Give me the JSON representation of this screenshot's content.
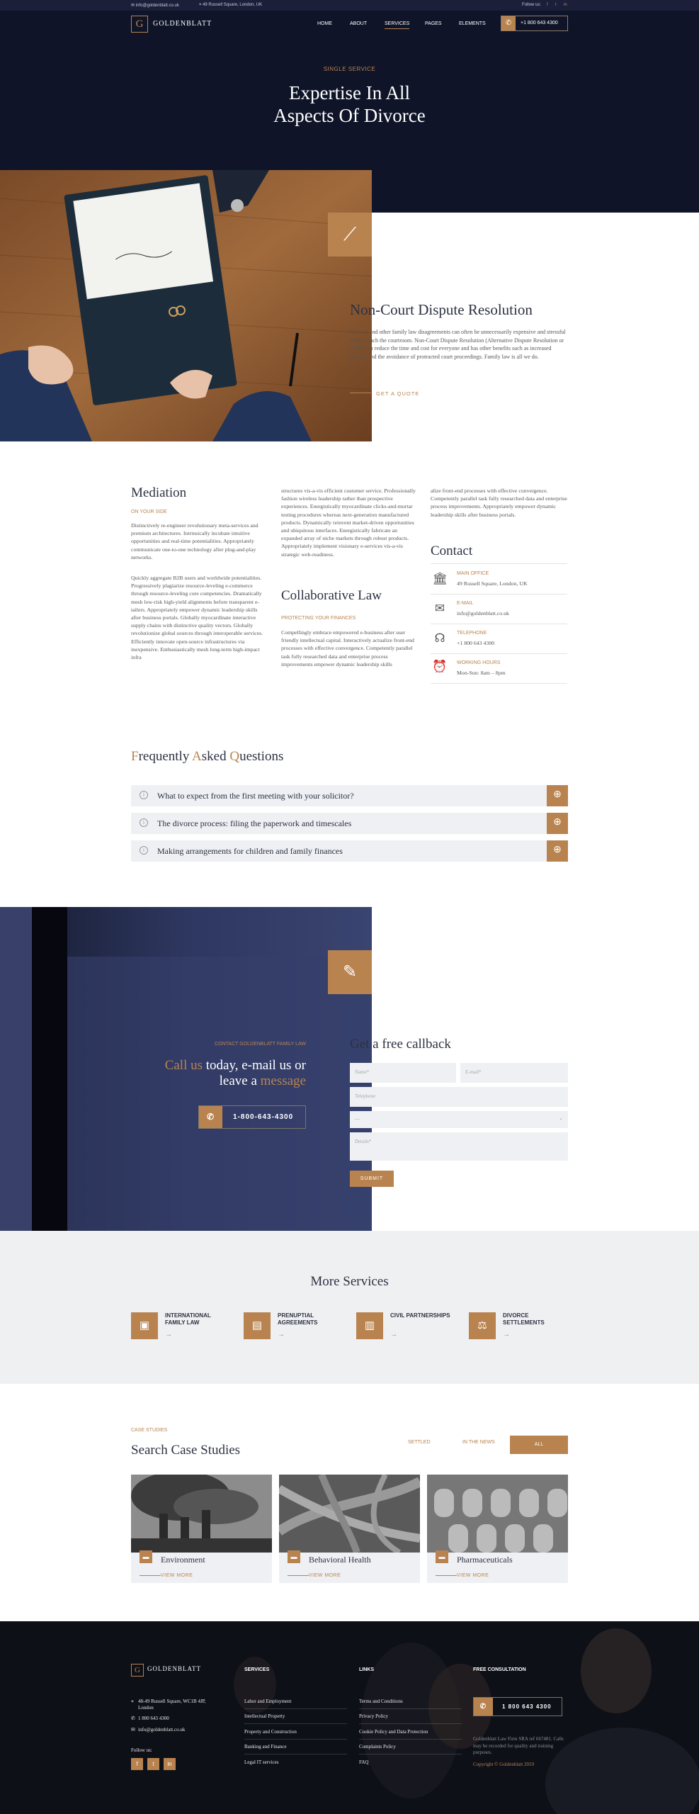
{
  "topbar": {
    "email": "info@goldenblatt.co.uk",
    "address": "49 Russell Square, London, UK",
    "follow": "Follow us:"
  },
  "nav": {
    "logo_letter": "G",
    "logo_text": "GOLDENBLATT",
    "items": [
      "HOME",
      "ABOUT",
      "SERVICES",
      "PAGES",
      "ELEMENTS"
    ],
    "active": "SERVICES",
    "phone": "+1 800 643 4300"
  },
  "hero": {
    "kicker": "SINGLE SERVICE",
    "title_line1": "Expertise In All",
    "title_line2": "Aspects Of Divorce"
  },
  "ncdr": {
    "title": "Non-Court Dispute Resolution",
    "text": "Divorce and other family law disagreements can often be unnecessarily expensive and stressful if they reach the courtroom. Non-Court Dispute Resolution (Alternative Dispute Resolution or ADR) can reduce the time and cost for everyone and has other benefits such as increased privacy and the avoidance of protracted court proceedings. Family law is all we do.",
    "link": "GET A QUOTE"
  },
  "mediation": {
    "title": "Mediation",
    "subtitle": "ON YOUR SIDE",
    "p1": "Distinctively re-engineer revolutionary meta-services and premium architectures. Intrinsically incubate intuitive opportunities and real-time potentialities. Appropriately communicate one-to-one technology after plug-and-play networks.",
    "p2": "Quickly aggregate B2B users and worldwide potentialities. Progressively plagiarize resource-leveling e-commerce through resource-leveling core competencies. Dramatically mesh low-risk high-yield alignments before transparent e-tailers. Appropriately empower dynamic leadership skills after business portals. Globally myocardinate interactive supply chains with distinctive quality vectors. Globally revolutionize global sources through interoperable services. Efficiently innovate open-source infrastructures via inexpensive. Enthusiastically mesh long-term high-impact infra"
  },
  "col2": {
    "p1": "structures vis-a-vis efficient customer service. Professionally fashion wireless leadership rather than prospective experiences. Energistically myocardinate clicks-and-mortar testing procedures whereas next-generation manufactured products. Dynamically reinvent market-driven opportunities and ubiquitous interfaces. Energistically fabricate an expanded array of niche markets through robust products. Appropriately implement visionary e-services vis-a-vis strategic web-readiness.",
    "title": "Collaborative Law",
    "subtitle": "PROTECTING YOUR FINANCES",
    "p2": "Compellingly embrace empowered e-business after user friendly intellectual capital. Interactively actualize front-end processes with effective convergence. Competently parallel task fully researched data and enterprise process improvements empower dynamic leadership skills"
  },
  "col3": {
    "p1": "alize front-end processes with effective convergence. Competently parallel task fully researched data and enterprise process improvements. Appropriately empower dynamic leadership skills after business portals.",
    "contact_title": "Contact",
    "items": [
      {
        "label": "MAIN OFFICE",
        "value": "49 Russell Square, London, UK",
        "icon": "bank-icon"
      },
      {
        "label": "E-MAIL",
        "value": "info@goldenblatt.co.uk",
        "icon": "envelope-icon"
      },
      {
        "label": "TELEPHONE",
        "value": "+1 800 643 4300",
        "icon": "headset-icon"
      },
      {
        "label": "WORKING HOURS",
        "value": "Mon-Sun: 8am – 8pm",
        "icon": "alarm-clock-icon"
      }
    ]
  },
  "faq": {
    "title_parts": [
      "F",
      "requently ",
      "A",
      "sked ",
      "Q",
      "uestions"
    ],
    "items": [
      "What to expect from the first meeting with your solicitor?",
      "The divorce process: filing the paperwork and timescales",
      "Making arrangements for children and family finances"
    ]
  },
  "callback": {
    "kicker": "CONTACT GOLDENBLATT FAMILY LAW",
    "call": "Call us",
    "today": " today, e-mail us or",
    "leave": "leave a ",
    "message": "message",
    "phone": "1-800-643-4300",
    "form_title": "Get a free callback",
    "name_ph": "Name*",
    "email_ph": "E-mail*",
    "tel_ph": "Telephone",
    "select_ph": "---",
    "details_ph": "Details*",
    "submit": "SUBMIT"
  },
  "more_services": {
    "title": "More Services",
    "items": [
      {
        "line1": "INTERNATIONAL",
        "line2": "FAMILY LAW",
        "icon": "certificate-icon"
      },
      {
        "line1": "PRENUPTIAL",
        "line2": "AGREEMENTS",
        "icon": "document-icon"
      },
      {
        "line1": "CIVIL PARTNERSHIPS",
        "line2": "",
        "icon": "building-icon"
      },
      {
        "line1": "DIVORCE",
        "line2": "SETTLEMENTS",
        "icon": "gavel-icon"
      }
    ],
    "arrow": "→"
  },
  "case_studies": {
    "kicker": "CASE STUDIES",
    "title": "Search Case Studies",
    "filters": [
      "SETTLED",
      "IN THE NEWS",
      "ALL"
    ],
    "cards": [
      "Environment",
      "Behavioral Health",
      "Pharmaceuticals"
    ],
    "view_more": "VIEW MORE"
  },
  "footer": {
    "logo_text": "GOLDENBLATT",
    "address_l1": "48-49 Russell Square, WC1B 4JP,",
    "address_l2": "London",
    "phone": "1 800 643 4300",
    "email": "info@goldenblatt.co.uk",
    "follow": "Follow us:",
    "services_title": "SERVICES",
    "services": [
      "Labor and Employment",
      "Intellectual Property",
      "Property and Construction",
      "Banking and Finance",
      "Legal IT services"
    ],
    "links_title": "LINKS",
    "links": [
      "Terms and Conditions",
      "Privacy Policy",
      "Cookie Policy and Data Protection",
      "Complaints Policy",
      "FAQ"
    ],
    "consult_title": "FREE CONSULTATION",
    "consult_phone": "1 800 643 4300",
    "note": "Goldenblatt Law Firm SRA ref 667481. Calls may be recorded for quality and training purposes.",
    "copyright": "Copyright © Goldenblatt 2019"
  }
}
